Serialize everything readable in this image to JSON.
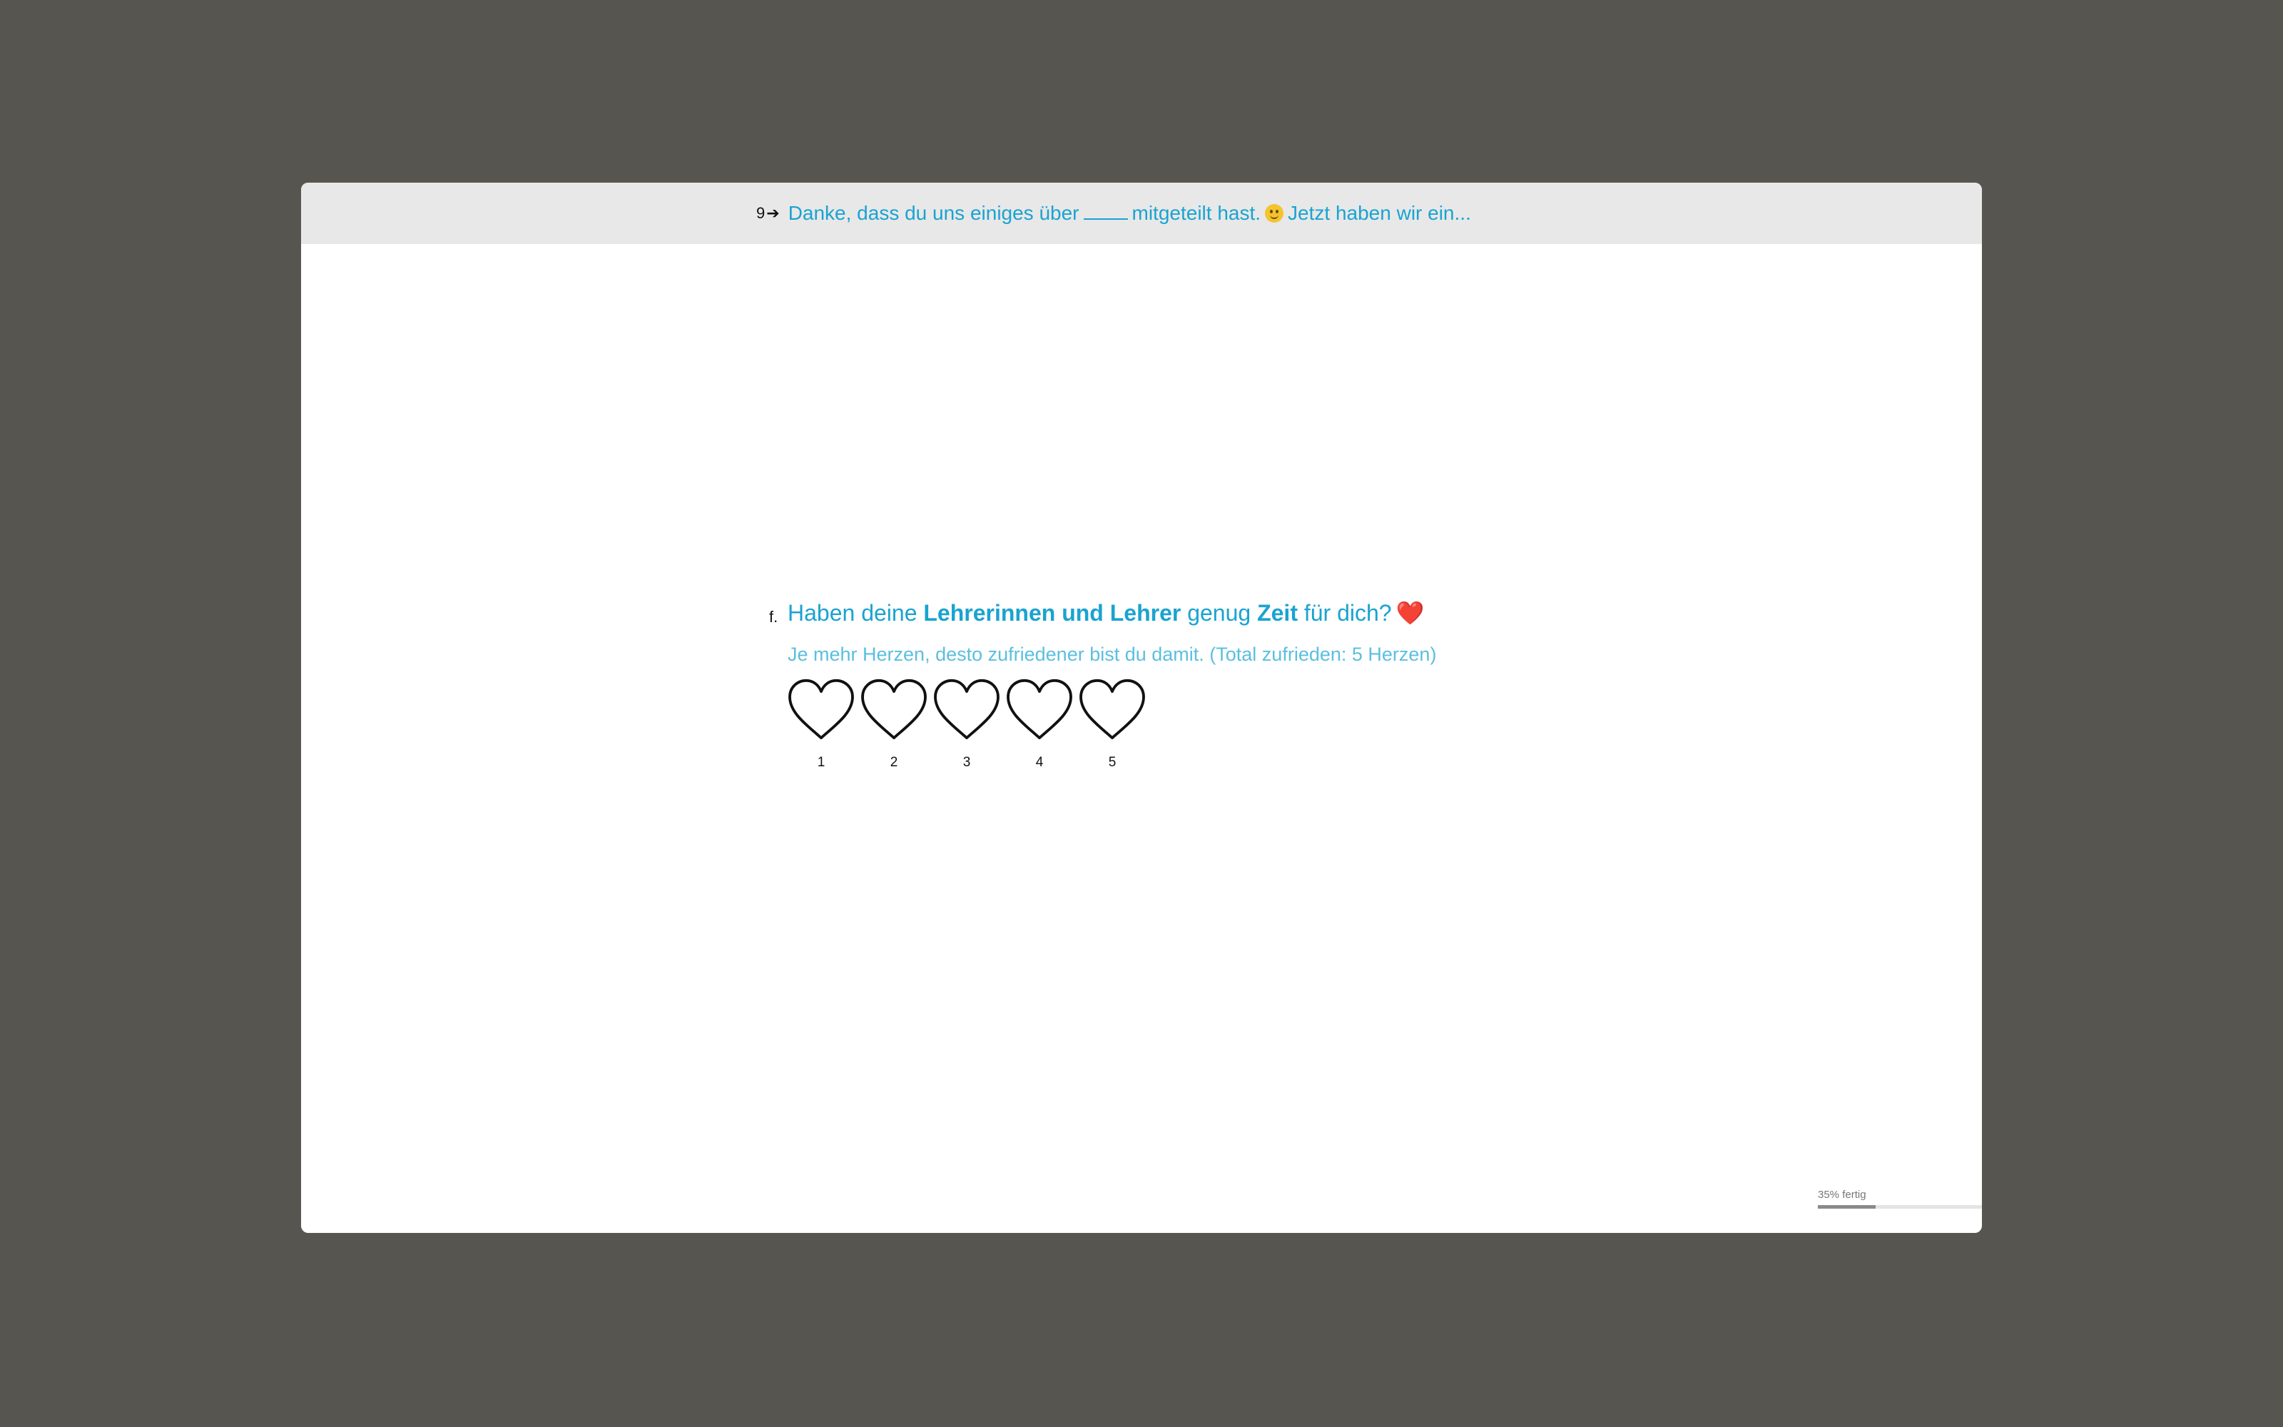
{
  "header": {
    "question_number": "9",
    "arrow": "➔",
    "title_before_blank": "Danke, dass du uns einiges über",
    "title_after_blank": "mitgeteilt hast.",
    "title_end": "Jetzt haben wir ein..."
  },
  "question": {
    "letter": "f.",
    "text_part1": "Haben deine ",
    "text_bold1": "Lehrerinnen und Lehrer",
    "text_part2": " genug ",
    "text_bold2": "Zeit",
    "text_part3": " für dich?",
    "heart_emoji": "❤️",
    "subtitle": "Je mehr Herzen, desto zufriedener bist du damit. (Total zufrieden: 5 Herzen)"
  },
  "rating": {
    "options": [
      "1",
      "2",
      "3",
      "4",
      "5"
    ],
    "selected": null,
    "max": 5
  },
  "progress": {
    "label": "35% fertig",
    "fraction": 0.35
  },
  "colors": {
    "accent": "#1aa3d1",
    "subtitle": "#5bbfe0",
    "background": "#57554f",
    "header_bg": "#e8e8e8",
    "heart_red": "#e02626"
  }
}
